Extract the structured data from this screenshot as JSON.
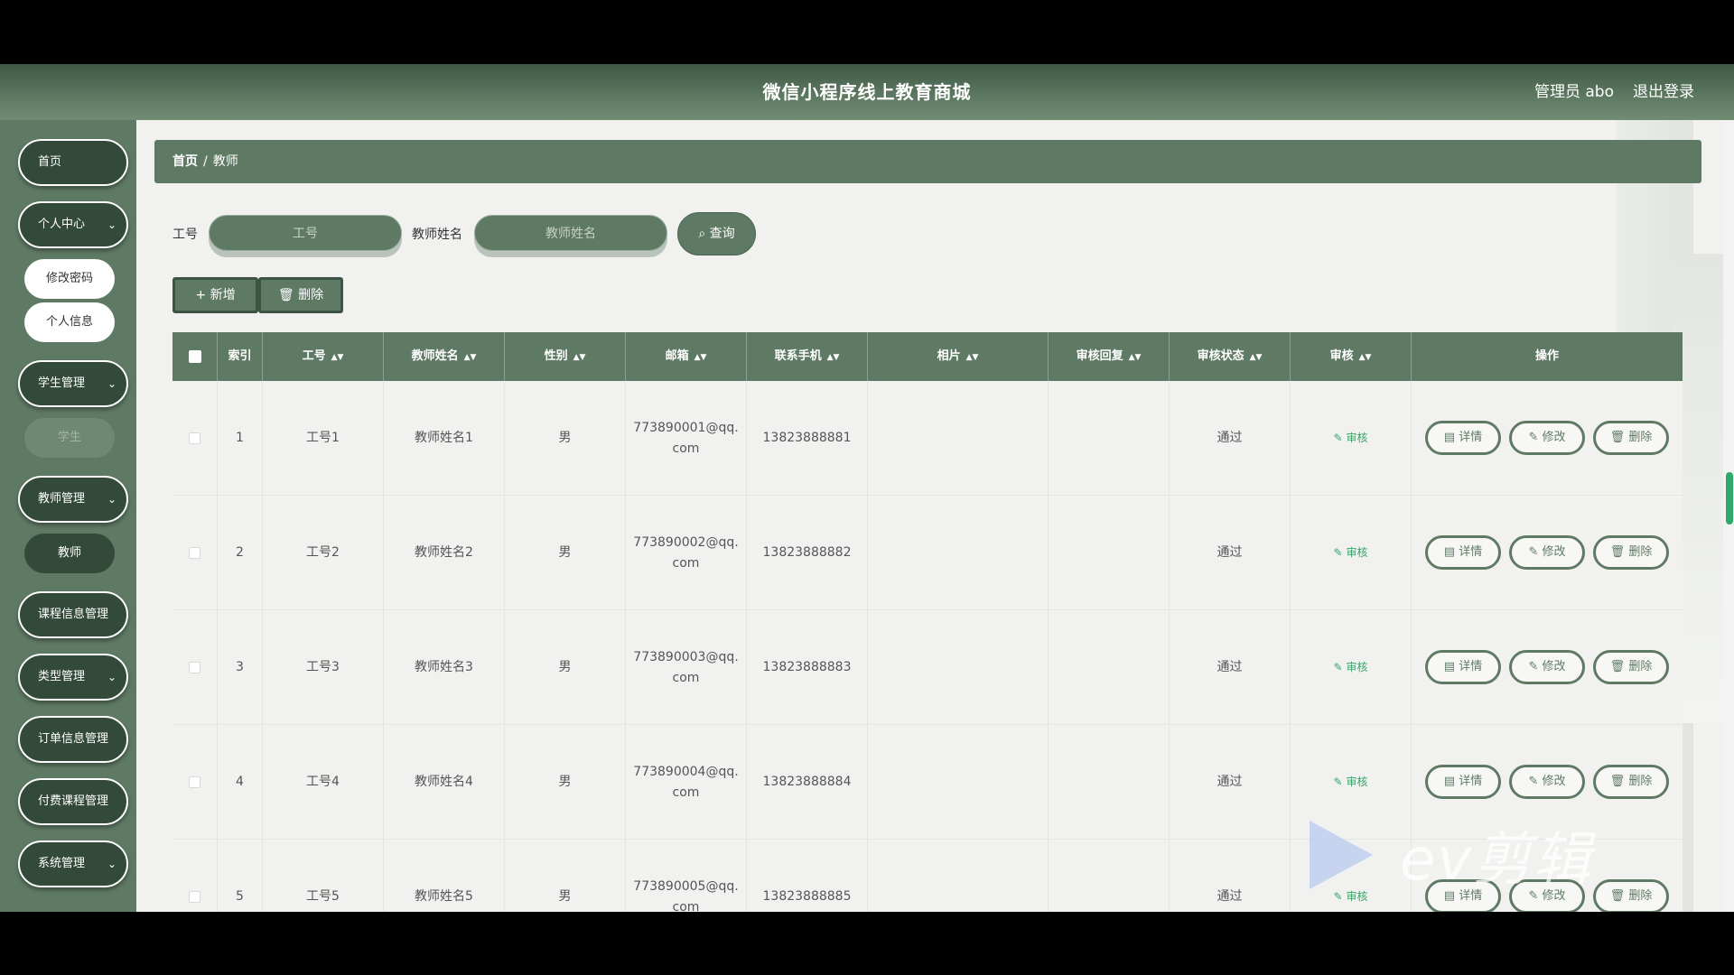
{
  "header": {
    "title": "微信小程序线上教育商城",
    "admin": "管理员 abo",
    "logout": "退出登录"
  },
  "sidebar": {
    "home": "首页",
    "personal": "个人中心",
    "change_password": "修改密码",
    "personal_info": "个人信息",
    "student_mgmt": "学生管理",
    "student": "学生",
    "teacher_mgmt": "教师管理",
    "teacher": "教师",
    "course_mgmt": "课程信息管理",
    "type_mgmt": "类型管理",
    "order_mgmt": "订单信息管理",
    "paid_course_mgmt": "付费课程管理",
    "system_mgmt": "系统管理"
  },
  "breadcrumb": {
    "home": "首页",
    "sep": "/",
    "current": "教师"
  },
  "search": {
    "id_label": "工号",
    "id_placeholder": "工号",
    "name_label": "教师姓名",
    "name_placeholder": "教师姓名",
    "query": "查询"
  },
  "toolbar": {
    "add": "+ 新增",
    "delete": "删除"
  },
  "table": {
    "headers": [
      "索引",
      "工号",
      "教师姓名",
      "性别",
      "邮箱",
      "联系手机",
      "相片",
      "审核回复",
      "审核状态",
      "审核",
      "操作"
    ],
    "rows": [
      {
        "index": "1",
        "id": "工号1",
        "name": "教师姓名1",
        "gender": "男",
        "email1": "773890001@qq.",
        "email2": "com",
        "phone": "13823888881",
        "status": "通过"
      },
      {
        "index": "2",
        "id": "工号2",
        "name": "教师姓名2",
        "gender": "男",
        "email1": "773890002@qq.",
        "email2": "com",
        "phone": "13823888882",
        "status": "通过"
      },
      {
        "index": "3",
        "id": "工号3",
        "name": "教师姓名3",
        "gender": "男",
        "email1": "773890003@qq.",
        "email2": "com",
        "phone": "13823888883",
        "status": "通过"
      },
      {
        "index": "4",
        "id": "工号4",
        "name": "教师姓名4",
        "gender": "男",
        "email1": "773890004@qq.",
        "email2": "com",
        "phone": "13823888884",
        "status": "通过"
      },
      {
        "index": "5",
        "id": "工号5",
        "name": "教师姓名5",
        "gender": "男",
        "email1": "773890005@qq.",
        "email2": "com",
        "phone": "13823888885",
        "status": "通过"
      }
    ],
    "audit_link": "审核",
    "actions": {
      "detail": "详情",
      "edit": "修改",
      "delete": "删除"
    }
  },
  "watermark": "ev剪辑",
  "colors": {
    "primary": "#5f7a64",
    "dark": "#334a3a",
    "audit": "#3aa36a"
  }
}
